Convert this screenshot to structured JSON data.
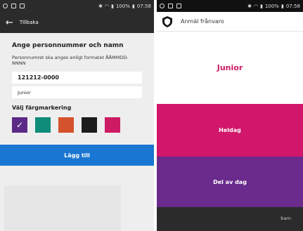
{
  "left_screen": {
    "status_bar": {
      "battery": "100%",
      "time": "07:58"
    },
    "app_bar": {
      "title": "Tillbaka"
    },
    "form": {
      "heading": "Ange personnummer och namn",
      "help_text": "Personnumret ska anges enligt formatet ÅÅMMDD-NNNN",
      "personnummer_value": "121212-0000",
      "name_value": "Junior",
      "color_heading": "Välj färgmarkering",
      "colors": [
        "#5b2a86",
        "#0f8c7a",
        "#d4522c",
        "#1c1c1c",
        "#cc1a63"
      ],
      "selected_color_index": 0,
      "check_glyph": "✓"
    },
    "submit_label": "Lägg till"
  },
  "right_screen": {
    "status_bar": {
      "battery": "100%",
      "time": "07:58"
    },
    "app_bar": {
      "title": "Anmäl frånvaro",
      "icon": "shield-icon"
    },
    "tiles": [
      {
        "label": "Junior"
      },
      {
        "label": "Heldag"
      },
      {
        "label": "Del av dag"
      }
    ],
    "bottom_fragment": "barn"
  }
}
